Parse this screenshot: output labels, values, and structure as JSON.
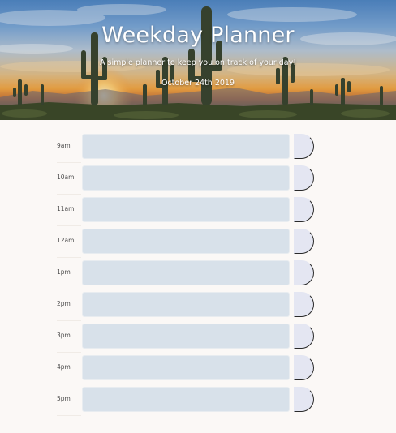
{
  "header": {
    "title": "Weekday Planner",
    "subtitle": "A simple planner to keep you on track of your day!",
    "date": "October 24th 2019"
  },
  "schedule": {
    "hours": [
      {
        "label": "9am",
        "text": ""
      },
      {
        "label": "10am",
        "text": ""
      },
      {
        "label": "11am",
        "text": ""
      },
      {
        "label": "12am",
        "text": ""
      },
      {
        "label": "1pm",
        "text": ""
      },
      {
        "label": "2pm",
        "text": ""
      },
      {
        "label": "3pm",
        "text": ""
      },
      {
        "label": "4pm",
        "text": ""
      },
      {
        "label": "5pm",
        "text": ""
      }
    ]
  },
  "colors": {
    "page_background": "#fbf8f6",
    "entry_field": "#d8e1ea",
    "save_button": "#e4e6f2",
    "hero_sky": "#4f86c4",
    "hero_sunset": "#f0a544"
  },
  "icons": {
    "hero_background": "desert-saguaro-sunset-photo"
  }
}
